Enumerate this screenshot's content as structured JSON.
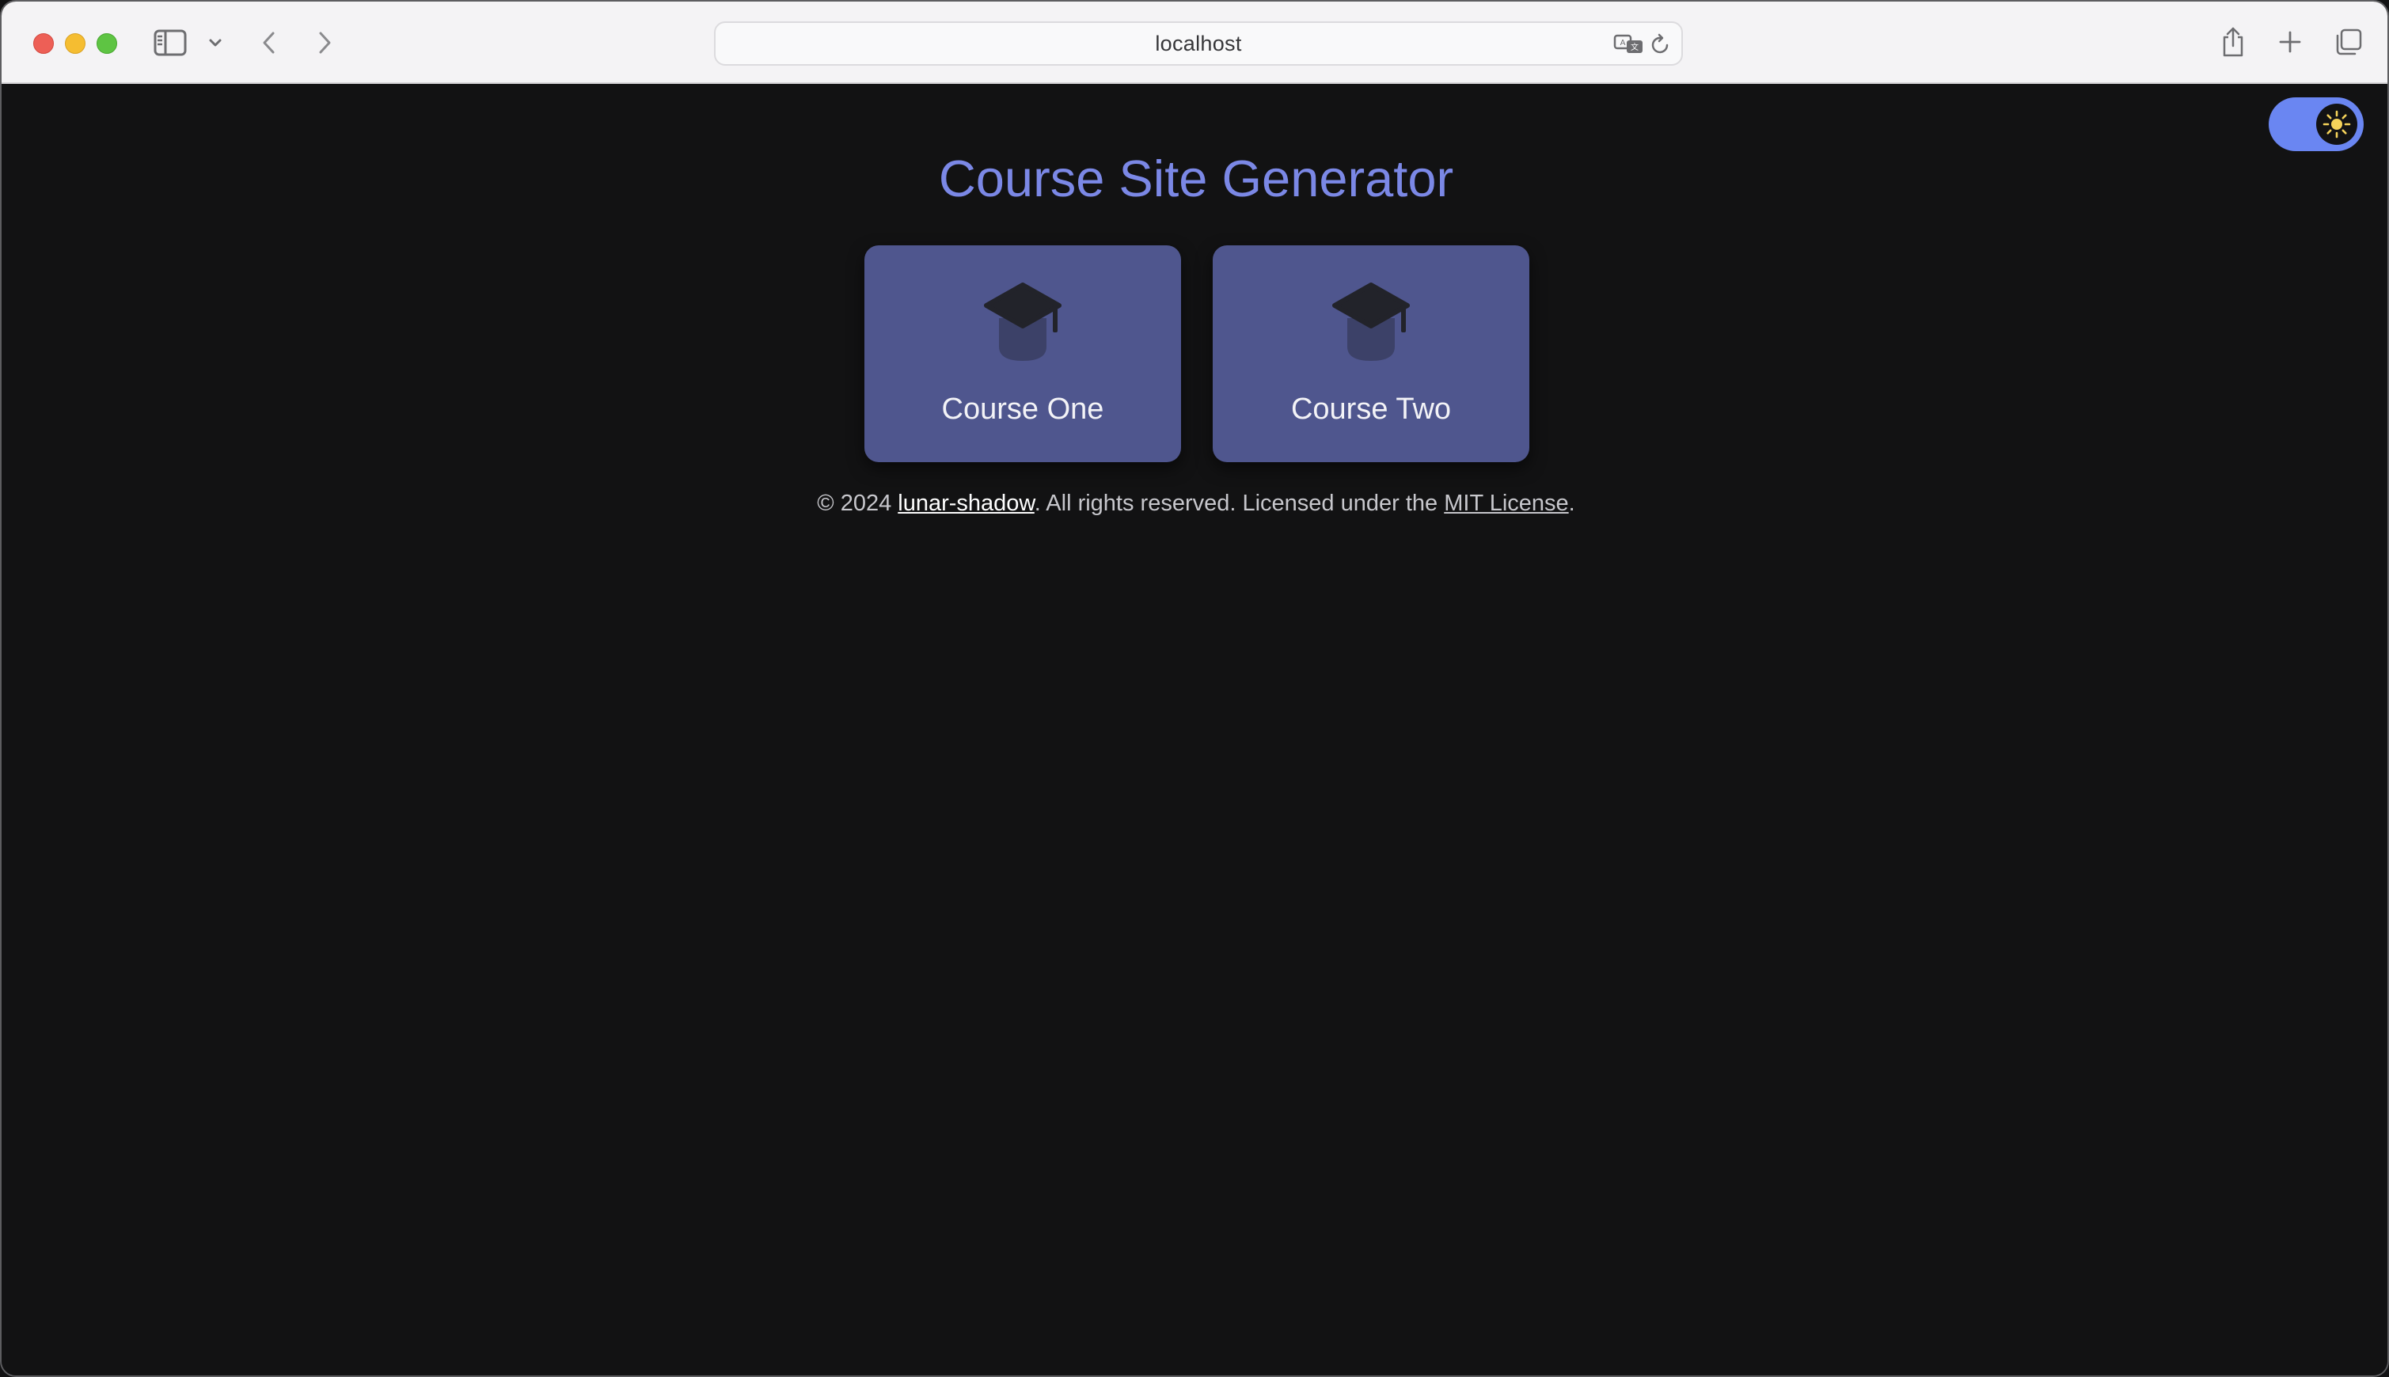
{
  "browser": {
    "address": "localhost",
    "icons": {
      "sidebar": "sidebar-icon",
      "chevron": "chevron-down-icon",
      "back": "back-arrow-icon",
      "forward": "forward-arrow-icon",
      "translate": "translate-icon",
      "reload": "reload-icon",
      "share": "share-icon",
      "new_tab": "plus-icon",
      "tabs": "tab-overview-icon"
    }
  },
  "page": {
    "title": "Course Site Generator",
    "theme_toggle": {
      "icon": "sun-icon",
      "state": "dark"
    },
    "courses": [
      {
        "label": "Course One",
        "icon": "graduation-cap-icon"
      },
      {
        "label": "Course Two",
        "icon": "graduation-cap-icon"
      }
    ],
    "footer": {
      "prefix": "© 2024 ",
      "author": "lunar-shadow",
      "middle": ". All rights reserved. Licensed under the ",
      "license": "MIT License",
      "suffix": "."
    }
  },
  "colors": {
    "background": "#121213",
    "title": "#7b88e6",
    "card": "#4f568e",
    "toggle": "#6a86f2",
    "sun": "#f5d35a"
  }
}
